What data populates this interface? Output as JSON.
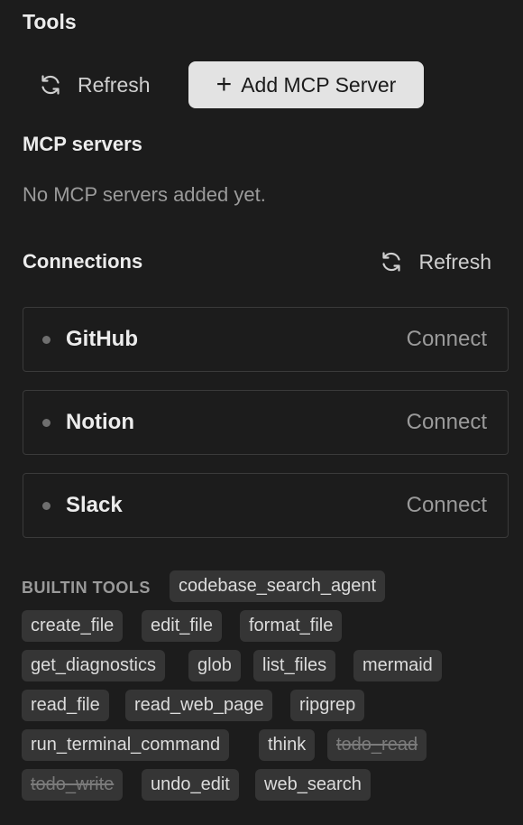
{
  "tools": {
    "title": "Tools",
    "refresh_label": "Refresh",
    "add_label": "Add MCP Server"
  },
  "mcp": {
    "title": "MCP servers",
    "empty_text": "No MCP servers added yet."
  },
  "connections": {
    "title": "Connections",
    "refresh_label": "Refresh",
    "items": [
      {
        "name": "GitHub",
        "action": "Connect"
      },
      {
        "name": "Notion",
        "action": "Connect"
      },
      {
        "name": "Slack",
        "action": "Connect"
      }
    ]
  },
  "builtin": {
    "label": "BUILTIN TOOLS",
    "tags": [
      {
        "name": "codebase_search_agent",
        "disabled": false
      },
      {
        "name": "create_file",
        "disabled": false
      },
      {
        "name": "edit_file",
        "disabled": false
      },
      {
        "name": "format_file",
        "disabled": false
      },
      {
        "name": "get_diagnostics",
        "disabled": false
      },
      {
        "name": "glob",
        "disabled": false
      },
      {
        "name": "list_files",
        "disabled": false
      },
      {
        "name": "mermaid",
        "disabled": false
      },
      {
        "name": "read_file",
        "disabled": false
      },
      {
        "name": "read_web_page",
        "disabled": false
      },
      {
        "name": "ripgrep",
        "disabled": false
      },
      {
        "name": "run_terminal_command",
        "disabled": false
      },
      {
        "name": "think",
        "disabled": false
      },
      {
        "name": "todo_read",
        "disabled": true
      },
      {
        "name": "todo_write",
        "disabled": true
      },
      {
        "name": "undo_edit",
        "disabled": false
      },
      {
        "name": "web_search",
        "disabled": false
      }
    ]
  },
  "icons": {
    "refresh": "refresh-icon",
    "plus": "plus-icon"
  }
}
